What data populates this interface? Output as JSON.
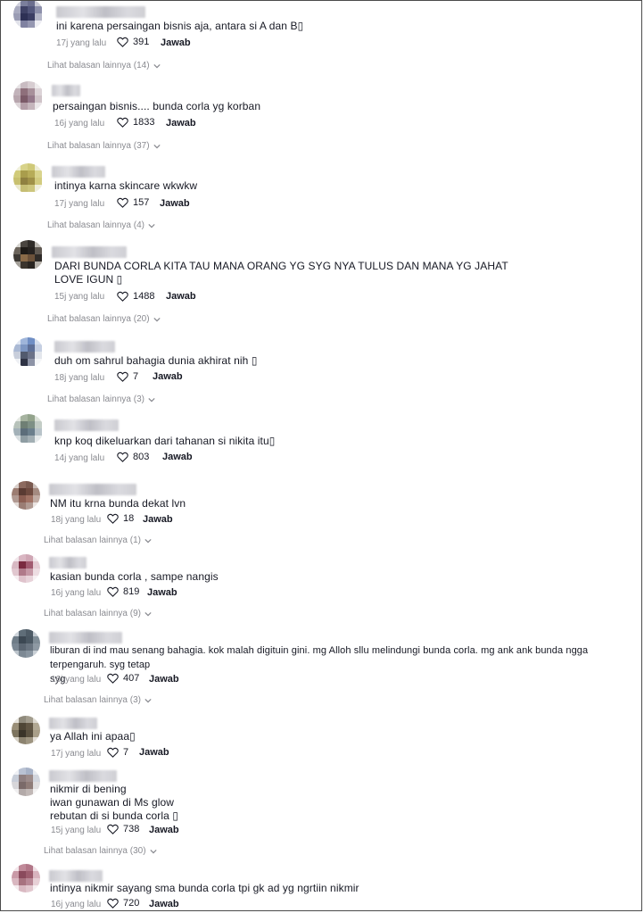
{
  "comments": [
    {
      "text": "ini karena persaingan bisnis aja, antara si A dan B▯",
      "time": "17j yang lalu",
      "likes": "391",
      "reply": "Jawab",
      "more": "Lihat balasan lainnya (14)"
    },
    {
      "text": "persaingan bisnis.... bunda corla yg korban",
      "time": "16j yang lalu",
      "likes": "1833",
      "reply": "Jawab",
      "more": "Lihat balasan lainnya (37)"
    },
    {
      "text": "intinya karna skincare wkwkw",
      "time": "17j yang lalu",
      "likes": "157",
      "reply": "Jawab",
      "more": "Lihat balasan lainnya (4)"
    },
    {
      "text": "DARI BUNDA CORLA KITA TAU MANA ORANG YG SYG NYA TULUS DAN MANA YG JAHAT\nLOVE IGUN ▯",
      "time": "15j yang lalu",
      "likes": "1488",
      "reply": "Jawab",
      "more": "Lihat balasan lainnya (20)"
    },
    {
      "text": "duh om sahrul bahagia dunia akhirat nih ▯",
      "time": "18j yang lalu",
      "likes": "7",
      "reply": "Jawab",
      "more": "Lihat balasan lainnya (3)"
    },
    {
      "text": "knp koq dikeluarkan dari tahanan si nikita itu▯",
      "time": "14j yang lalu",
      "likes": "803",
      "reply": "Jawab",
      "more": ""
    },
    {
      "text": "NM itu krna bunda dekat lvn",
      "time": "18j yang lalu",
      "likes": "18",
      "reply": "Jawab",
      "more": "Lihat balasan lainnya (1)"
    },
    {
      "text": "kasian bunda corla , sampe nangis",
      "time": "16j yang lalu",
      "likes": "819",
      "reply": "Jawab",
      "more": "Lihat balasan lainnya (9)"
    },
    {
      "text": "liburan di ind mau senang bahagia. kok malah digituin gini. mg Alloh sllu melindungi bunda corla. mg ank ank bunda ngga terpengaruh. syg tetap\nsyg",
      "time": "16j yang lalu",
      "likes": "407",
      "reply": "Jawab",
      "more": "Lihat balasan lainnya (3)"
    },
    {
      "text": "ya Allah ini apaa▯",
      "time": "17j yang lalu",
      "likes": "7",
      "reply": "Jawab",
      "more": ""
    },
    {
      "text": "nikmir di bening\niwan gunawan di Ms glow\nrebutan di si bunda corla ▯",
      "time": "15j yang lalu",
      "likes": "738",
      "reply": "Jawab",
      "more": "Lihat balasan lainnya (30)"
    },
    {
      "text": "intinya nikmir sayang sma bunda corla tpi gk ad yg ngrtiin nikmir",
      "time": "16j yang lalu",
      "likes": "720",
      "reply": "Jawab",
      "more": ""
    }
  ],
  "icons": {
    "like": "heart-outline-icon",
    "expand": "chevron-down-icon"
  }
}
